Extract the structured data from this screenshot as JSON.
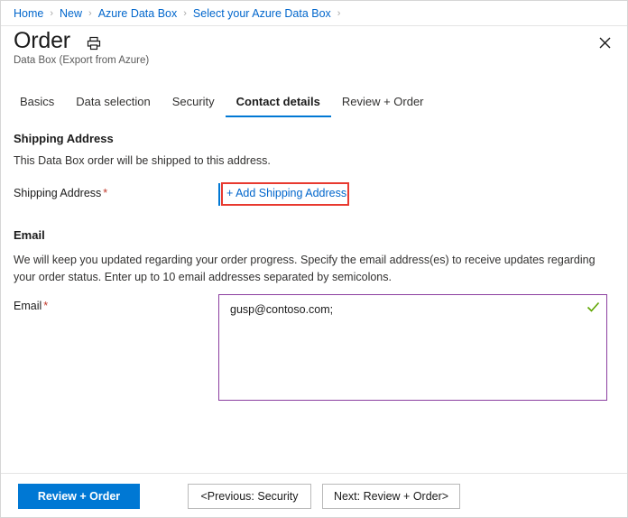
{
  "window": {
    "close_icon": "close-icon"
  },
  "breadcrumb": {
    "items": [
      {
        "label": "Home"
      },
      {
        "label": "New"
      },
      {
        "label": "Azure Data Box"
      },
      {
        "label": "Select your Azure Data Box"
      }
    ],
    "separator": "›",
    "trailing_separator": "›"
  },
  "header": {
    "title": "Order",
    "subtitle": "Data Box (Export from Azure)",
    "print_icon": "print-icon"
  },
  "tabs": [
    {
      "label": "Basics",
      "active": false
    },
    {
      "label": "Data selection",
      "active": false
    },
    {
      "label": "Security",
      "active": false
    },
    {
      "label": "Contact details",
      "active": true
    },
    {
      "label": "Review + Order",
      "active": false
    }
  ],
  "shipping_section": {
    "heading": "Shipping Address",
    "description": "This Data Box order will be shipped to this address.",
    "field_label": "Shipping Address",
    "required_marker": "*",
    "add_link_label": "+ Add Shipping Address"
  },
  "email_section": {
    "heading": "Email",
    "description": "We will keep you updated regarding your order progress. Specify the email address(es) to receive updates regarding your order status. Enter up to 10 email addresses separated by semicolons.",
    "field_label": "Email",
    "required_marker": "*",
    "value": "gusp@contoso.com;",
    "placeholder": "",
    "validation_icon": "checkmark-icon"
  },
  "footer": {
    "primary_label": "Review + Order",
    "previous_label": "<Previous: Security",
    "next_label": "Next: Review + Order>"
  },
  "colors": {
    "accent": "#0078d4",
    "link": "#0066cc",
    "required": "#c0392b",
    "callout": "#e8392f",
    "input_border_focus": "#8b3fa0",
    "valid": "#5ea500"
  }
}
